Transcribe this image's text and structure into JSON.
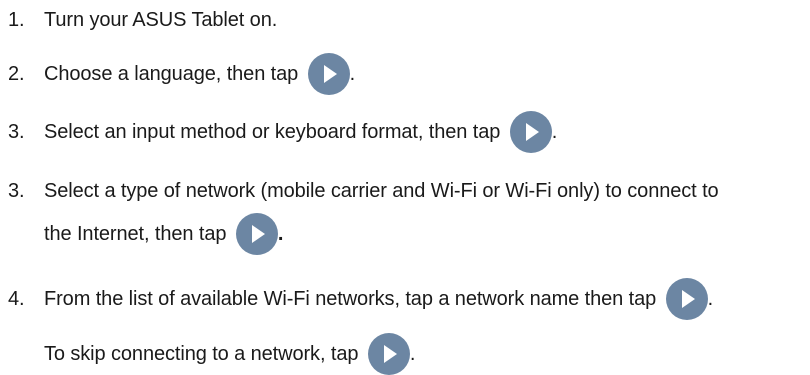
{
  "steps": [
    {
      "number": "1.",
      "text": "Turn your ASUS Tablet on."
    },
    {
      "number": "2.",
      "text": "Choose a language, then tap",
      "after": "."
    },
    {
      "number": "3.",
      "text": "Select an input method or keyboard format, then tap",
      "after": "."
    },
    {
      "number": "3.",
      "text": "Select a type of network (mobile carrier and Wi-Fi or Wi-Fi only) to connect to",
      "continuation": "the Internet, then tap",
      "after": "."
    },
    {
      "number": "4.",
      "text": "From the list of available Wi-Fi networks, tap a network name then tap",
      "after": ".",
      "continuation": "To skip connecting to a network, tap",
      "continuation_after": "."
    }
  ],
  "icon": {
    "name": "next-arrow-icon",
    "color": "#6c86a3"
  }
}
